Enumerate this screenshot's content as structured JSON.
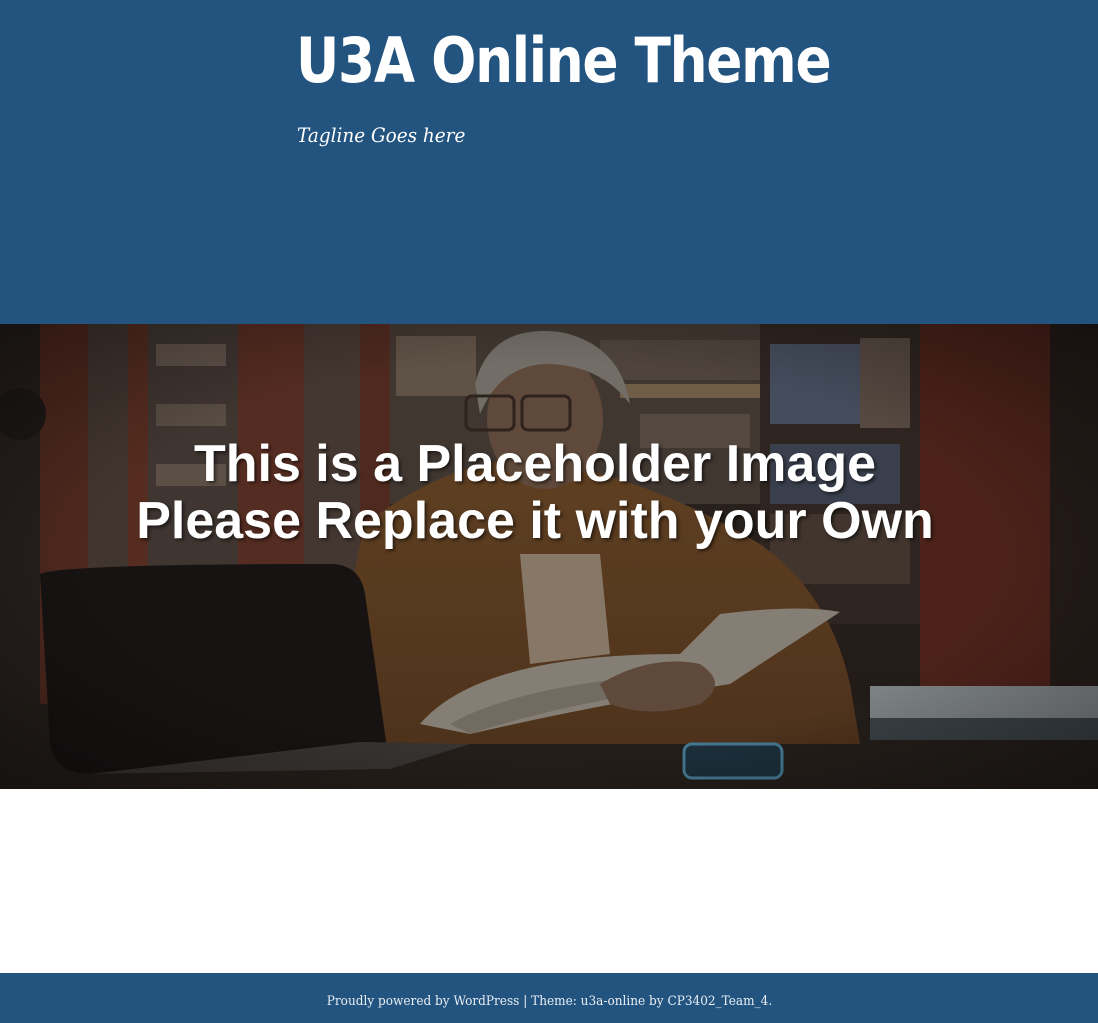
{
  "header": {
    "site_title": "U3A Online Theme",
    "tagline": "Tagline Goes here",
    "background_color": "#22547f"
  },
  "hero": {
    "caption_line_1": "This is a Placeholder Image",
    "caption_line_2": "Please Replace it with your Own"
  },
  "footer": {
    "powered_prefix": "Proudly powered by ",
    "wordpress_link": "WordPress",
    "separator": " | ",
    "theme_label": "Theme: u3a-online by ",
    "author_link": "CP3402_Team_4",
    "suffix": ".",
    "background_color": "#22547f"
  }
}
